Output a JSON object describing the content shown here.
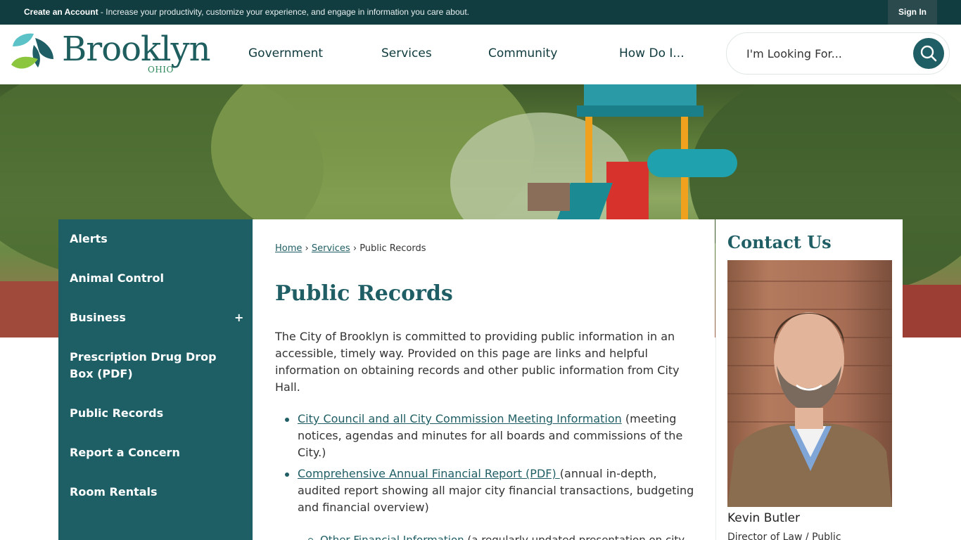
{
  "topbar": {
    "promo_link": "Create an Account",
    "promo_text": " - Increase your productivity, customize your experience, and engage in information you care about.",
    "signin": "Sign In"
  },
  "header": {
    "logo_word": "Brooklyn",
    "logo_state": "OHIO",
    "nav": [
      "Government",
      "Services",
      "Community",
      "How Do I..."
    ],
    "search_placeholder": "I'm Looking For..."
  },
  "sidenav": {
    "items": [
      "Alerts",
      "Animal Control",
      "Business",
      "Prescription Drug Drop Box (PDF)",
      "Public Records",
      "Report a Concern",
      "Room Rentals"
    ],
    "expand_symbol": "+"
  },
  "main": {
    "breadcrumb": {
      "home": "Home",
      "sep": "›",
      "services": "Services",
      "current": "Public Records"
    },
    "title": "Public Records",
    "intro": "The City of Brooklyn is committed to providing public information in an accessible, timely way. Provided on this page are links and helpful information on obtaining records and other public information from City Hall.",
    "list": [
      {
        "link": "City Council and all City Commission Meeting Information",
        "text": " (meeting notices, agendas and minutes for all boards and commissions of the City.)"
      },
      {
        "link": "Comprehensive Annual Financial Report (PDF) ",
        "text": "(annual in-depth, audited report showing all major city financial transactions, budgeting and financial overview)"
      }
    ],
    "sublist": {
      "link": "Other Financial Information",
      "text": " (a regularly updated presentation on city"
    }
  },
  "right": {
    "heading": "Contact Us",
    "name": "Kevin Butler",
    "role": "Director of Law / Public"
  },
  "colors": {
    "topbar": "#113c40",
    "brand_teal": "#1f5e64",
    "sidenav": "#1e5f66"
  }
}
